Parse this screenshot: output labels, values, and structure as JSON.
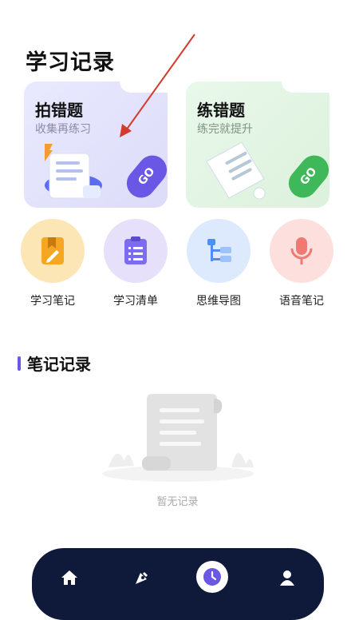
{
  "page": {
    "title": "学习记录"
  },
  "cards": [
    {
      "title": "拍错题",
      "subtitle": "收集再练习",
      "go": "GO"
    },
    {
      "title": "练错题",
      "subtitle": "练完就提升",
      "go": "GO"
    }
  ],
  "quick_actions": [
    {
      "label": "学习笔记",
      "icon": "notebook-icon",
      "color": "#f5a623"
    },
    {
      "label": "学习清单",
      "icon": "checklist-icon",
      "color": "#7b6cf0"
    },
    {
      "label": "思维导图",
      "icon": "mindmap-icon",
      "color": "#4e8ef7"
    },
    {
      "label": "语音笔记",
      "icon": "microphone-icon",
      "color": "#f07a72"
    }
  ],
  "notes": {
    "section_title": "笔记记录",
    "empty_text": "暂无记录"
  },
  "nav": {
    "items": [
      "home-icon",
      "pen-icon",
      "clock-icon",
      "user-icon"
    ],
    "active": 2
  },
  "colors": {
    "accent": "#6b57e6",
    "nav_bg": "#0f1a3a",
    "green": "#3fb85a"
  }
}
